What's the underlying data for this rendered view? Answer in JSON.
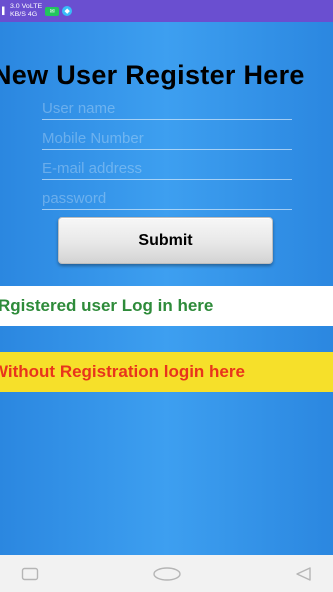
{
  "status_bar": {
    "signal_left": "▌",
    "line1": "3.0 VoLTE",
    "line2": "KB/S 4G",
    "chip": "✉",
    "dot": "◆"
  },
  "page": {
    "title": "New User Register Here"
  },
  "form": {
    "username_hint": "User name",
    "mobile_hint": "Mobile Number",
    "email_hint": "E-mail address",
    "password_hint": "password",
    "submit_label": "Submit"
  },
  "links": {
    "registered_login": "Rgistered user Log in here",
    "guest_login": "Without Registration login here"
  },
  "nav_bar": {
    "icons": [
      "recent-apps-icon",
      "home-icon",
      "back-icon"
    ]
  },
  "colors": {
    "status_bar": "#6a4fd0",
    "background": "#2f8fe6",
    "login_text": "#2e8b3a",
    "guest_background": "#f6e02a",
    "guest_text": "#e8341c"
  }
}
